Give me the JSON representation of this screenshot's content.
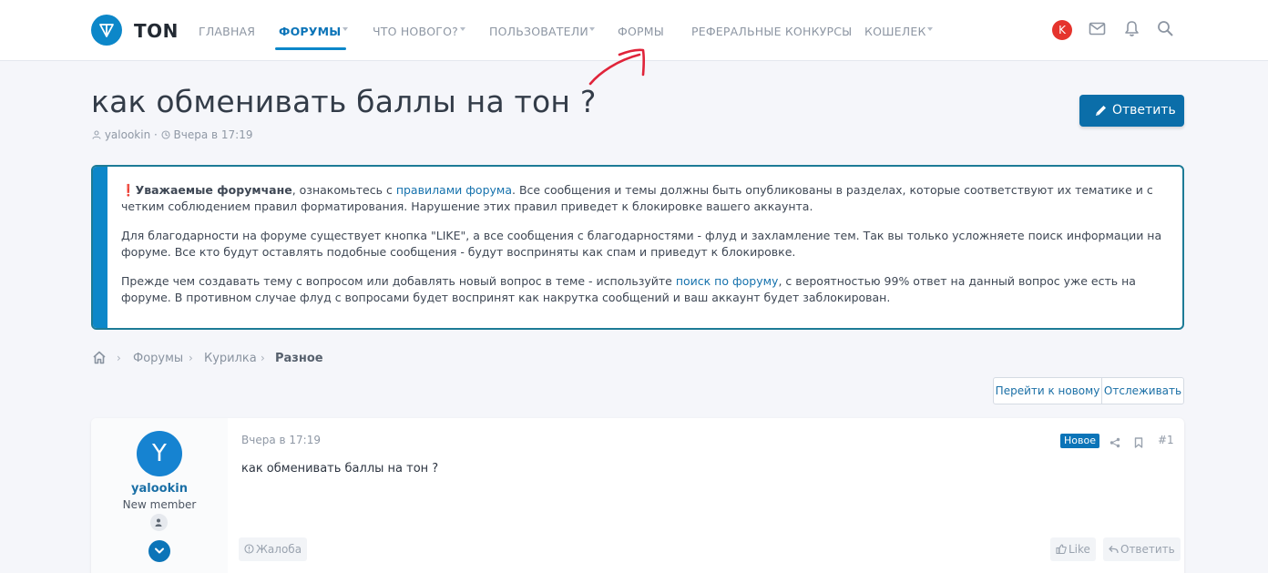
{
  "header": {
    "logo_text": "TON",
    "nav": [
      {
        "label": "ГЛАВНАЯ"
      },
      {
        "label": "ФОРУМЫ"
      },
      {
        "label": "ЧТО НОВОГО?"
      },
      {
        "label": "ПОЛЬЗОВАТЕЛИ"
      },
      {
        "label": "ФОРМЫ"
      },
      {
        "label": "РЕФЕРАЛЬНЫЕ КОНКУРСЫ"
      },
      {
        "label": "КОШЕЛЕК"
      }
    ],
    "active_nav": "ФОРУМЫ",
    "user_initial": "K",
    "icons": [
      "mail-icon",
      "bell-icon",
      "search-icon"
    ]
  },
  "thread": {
    "title": "как обменивать баллы на тон ?",
    "author": "yalookin",
    "separator": "·",
    "date": "Вчера в 17:19",
    "reply_label": "Ответить"
  },
  "notice": {
    "p1": {
      "bold": "Уважаемые форумчане",
      "pre_link": ", ознакомьтесь с ",
      "link": "правилами форума",
      "post_link": ". Все сообщения и темы должны быть опубликованы в разделах, которые соответствуют их тематике и с четким соблюдением правил форматирования. Нарушение этих правил приведет к блокировке вашего аккаунта."
    },
    "p2": "Для благодарности на форуме существует кнопка \"LIKE\", а все сообщения с благодарностями - флуд и захламление тем. Так вы только усложняете поиск информации на форуме. Все кто будут оставлять подобные сообщения - будут восприняты как спам и приведут к блокировке.",
    "p3": {
      "pre_link": "Прежде чем создавать тему с вопросом или добавлять новый вопрос в теме - используйте ",
      "link": "поиск по форуму",
      "post_link": ", с вероятностью 99% ответ на данный вопрос уже есть на форуме. В противном случае флуд с вопросами будет воспринят как накрутка сообщений и ваш аккаунт будет заблокирован."
    }
  },
  "breadcrumb": {
    "items": [
      "Форумы",
      "Курилка"
    ],
    "current": "Разное"
  },
  "actions": {
    "goto_new": "Перейти к новому",
    "watch": "Отслеживать"
  },
  "post": {
    "avatar_letter": "Y",
    "username": "yalookin",
    "user_title": "New member",
    "date": "Вчера в 17:19",
    "badge_new": "Новое",
    "number": "#1",
    "text": "как обменивать баллы на тон ?",
    "report": "Жалоба",
    "like": "Like",
    "reply": "Ответить"
  },
  "colors": {
    "accent": "#0c87c9",
    "primary_button": "#0b6ea9",
    "notice_border": "#1d7b96",
    "avatar_user": "#e5342d",
    "annotation_arrow": "#e0243a"
  }
}
